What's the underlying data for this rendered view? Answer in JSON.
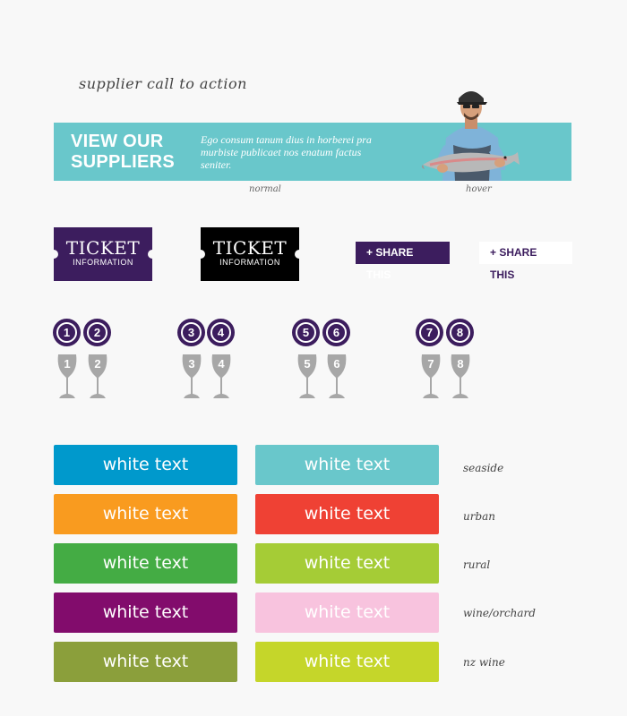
{
  "section_title": "supplier call to action",
  "banner": {
    "title": "VIEW OUR SUPPLIERS",
    "description": "Ego consum tanum dius in horberei pra murbiste publicaet nos enatum factus seniter.",
    "caption_normal": "normal",
    "caption_hover": "hover"
  },
  "tickets": [
    {
      "line1": "TICKET",
      "line2": "INFORMATION",
      "color": "#3c1d5e"
    },
    {
      "line1": "TICKET",
      "line2": "INFORMATION",
      "color": "#000000"
    }
  ],
  "share": [
    {
      "label": "+ SHARE THIS",
      "style": "dark"
    },
    {
      "label": "+ SHARE THIS",
      "style": "light"
    }
  ],
  "badges": [
    "1",
    "2",
    "3",
    "4",
    "5",
    "6",
    "7",
    "8"
  ],
  "glasses": [
    "1",
    "2",
    "3",
    "4",
    "5",
    "6",
    "7",
    "8"
  ],
  "color_rows": [
    {
      "label": "seaside",
      "buttons": [
        {
          "text": "white text",
          "color": "#0099cc"
        },
        {
          "text": "white text",
          "color": "#69c7cb"
        }
      ]
    },
    {
      "label": "urban",
      "buttons": [
        {
          "text": "white text",
          "color": "#f99b1f"
        },
        {
          "text": "white text",
          "color": "#ef4134"
        }
      ]
    },
    {
      "label": "rural",
      "buttons": [
        {
          "text": "white text",
          "color": "#44ac44"
        },
        {
          "text": "white text",
          "color": "#a5cc36"
        }
      ]
    },
    {
      "label": "wine/orchard",
      "buttons": [
        {
          "text": "white text",
          "color": "#820c6c"
        },
        {
          "text": "white text",
          "color": "#f8c3de"
        }
      ]
    },
    {
      "label": "nz wine",
      "buttons": [
        {
          "text": "white text",
          "color": "#8b9f3b"
        },
        {
          "text": "white text",
          "color": "#c5d62a"
        }
      ]
    }
  ]
}
